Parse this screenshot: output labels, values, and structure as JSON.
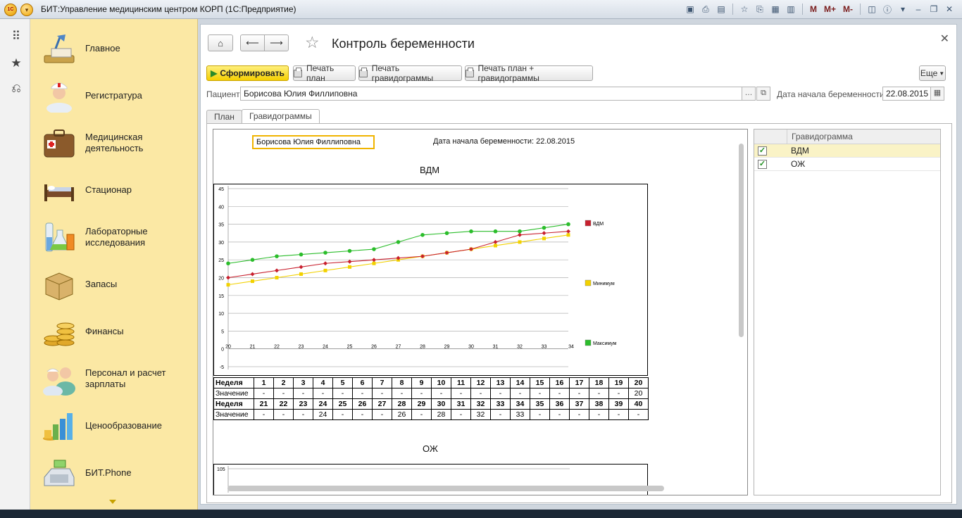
{
  "window": {
    "title": "БИТ:Управление медицинским центром КОРП  (1С:Предприятие)",
    "app_logo": "1С",
    "tools": [
      "M",
      "M+",
      "M-"
    ]
  },
  "sections": [
    {
      "label": "Главное",
      "icon": "desk-lamp-icon"
    },
    {
      "label": "Регистратура",
      "icon": "nurse-icon"
    },
    {
      "label": "Медицинская деятельность",
      "icon": "medical-case-icon"
    },
    {
      "label": "Стационар",
      "icon": "hospital-bed-icon"
    },
    {
      "label": "Лабораторные исследования",
      "icon": "lab-flasks-icon"
    },
    {
      "label": "Запасы",
      "icon": "box-icon"
    },
    {
      "label": "Финансы",
      "icon": "coins-icon"
    },
    {
      "label": "Персонал и расчет зарплаты",
      "icon": "staff-icon"
    },
    {
      "label": "Ценообразование",
      "icon": "price-chart-icon"
    },
    {
      "label": "БИТ.Phone",
      "icon": "phone-icon"
    }
  ],
  "form": {
    "title": "Контроль беременности",
    "buttons": {
      "generate": "Сформировать",
      "print_plan": "Печать план",
      "print_grav": "Печать гравидограммы",
      "print_both": "Печать план + гравидограммы",
      "more": "Еще"
    },
    "patient_label": "Пациент:",
    "patient_value": "Борисова Юлия Филлиповна",
    "pregnancy_date_label": "Дата начала беременности:",
    "pregnancy_date_value": "22.08.2015",
    "tabs": [
      "План",
      "Гравидограммы"
    ],
    "active_tab": 1
  },
  "document": {
    "patient": "Борисова Юлия  Филлиповна",
    "pregnancy_line": "Дата начала беременности: 22.08.2015",
    "chart1_title": "ВДМ",
    "chart2_title": "ОЖ",
    "table": {
      "week_label": "Неделя",
      "value_label": "Значение",
      "weeks_row1": [
        "1",
        "2",
        "3",
        "4",
        "5",
        "6",
        "7",
        "8",
        "9",
        "10",
        "11",
        "12",
        "13",
        "14",
        "15",
        "16",
        "17",
        "18",
        "19",
        "20"
      ],
      "values_row1": [
        "-",
        "-",
        "-",
        "-",
        "-",
        "-",
        "-",
        "-",
        "-",
        "-",
        "-",
        "-",
        "-",
        "-",
        "-",
        "-",
        "-",
        "-",
        "-",
        "20"
      ],
      "weeks_row2": [
        "21",
        "22",
        "23",
        "24",
        "25",
        "26",
        "27",
        "28",
        "29",
        "30",
        "31",
        "32",
        "33",
        "34",
        "35",
        "36",
        "37",
        "38",
        "39",
        "40"
      ],
      "values_row2": [
        "-",
        "-",
        "-",
        "24",
        "-",
        "-",
        "-",
        "26",
        "-",
        "28",
        "-",
        "32",
        "-",
        "33",
        "-",
        "-",
        "-",
        "-",
        "-",
        "-"
      ]
    }
  },
  "chart_data": [
    {
      "type": "line",
      "title": "ВДМ",
      "x": [
        20,
        21,
        22,
        23,
        24,
        25,
        26,
        27,
        28,
        29,
        30,
        31,
        32,
        33,
        34
      ],
      "x_tick_labels": [
        "20",
        "21",
        "22",
        "23",
        "24",
        "25",
        "26",
        "27",
        "28",
        "29",
        "30",
        "31",
        "32",
        "33",
        "34"
      ],
      "ylim": [
        -5,
        45
      ],
      "y_ticks": [
        -5,
        0,
        5,
        10,
        15,
        20,
        25,
        30,
        35,
        40,
        45
      ],
      "grid": true,
      "legend_position": "right",
      "series": [
        {
          "name": "ВДМ",
          "color": "#c8202e",
          "marker": "diamond",
          "values": [
            20,
            21,
            22,
            23,
            24,
            24.5,
            25,
            25.5,
            26,
            27,
            28,
            30,
            32,
            32.5,
            33
          ]
        },
        {
          "name": "Минимум",
          "color": "#f2d100",
          "marker": "square",
          "values": [
            18,
            19,
            20,
            21,
            22,
            23,
            24,
            25,
            26,
            27,
            28,
            29,
            30,
            31,
            32
          ]
        },
        {
          "name": "Максимум",
          "color": "#2bbd2b",
          "marker": "circle",
          "values": [
            24,
            25,
            26,
            26.5,
            27,
            27.5,
            28,
            30,
            32,
            32.5,
            33,
            33,
            33,
            34,
            35
          ]
        }
      ]
    },
    {
      "type": "line",
      "title": "ОЖ",
      "y_visible_tick": "105"
    }
  ],
  "gravidograms": {
    "header": "Гравидограмма",
    "items": [
      {
        "name": "ВДМ",
        "checked": true,
        "selected": true
      },
      {
        "name": "ОЖ",
        "checked": true,
        "selected": false
      }
    ]
  }
}
